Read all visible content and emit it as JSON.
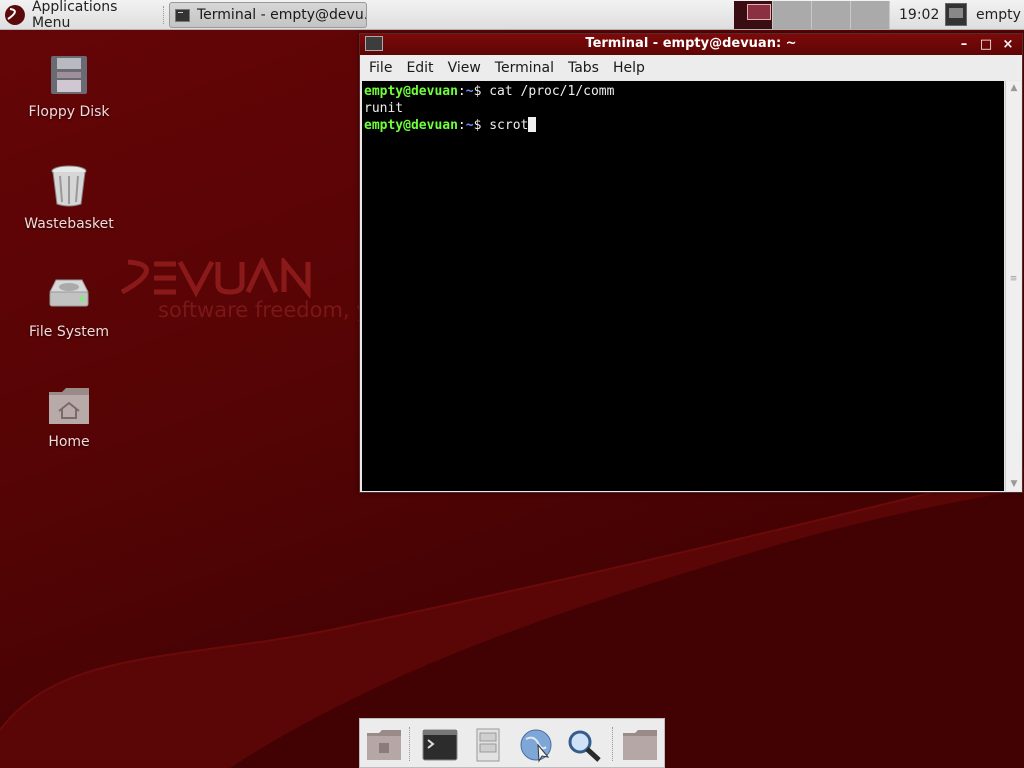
{
  "top_panel": {
    "apps_menu_label": "Applications Menu",
    "taskbar_title": "Terminal - empty@devu...",
    "clock": "19:02",
    "user": "empty",
    "workspace_count": 4,
    "active_workspace": 1
  },
  "wallpaper": {
    "logo_text": "DEVUAN",
    "tagline": "software freedom, y"
  },
  "desktop_icons": [
    {
      "label": "Floppy Disk"
    },
    {
      "label": "Wastebasket"
    },
    {
      "label": "File System"
    },
    {
      "label": "Home"
    }
  ],
  "terminal": {
    "title": "Terminal - empty@devuan: ~",
    "menu": [
      "File",
      "Edit",
      "View",
      "Terminal",
      "Tabs",
      "Help"
    ],
    "lines": [
      {
        "user": "empty@devuan",
        "sep": ":",
        "path": "~",
        "sym": "$ ",
        "cmd": "cat /proc/1/comm"
      },
      {
        "output": "runit"
      },
      {
        "user": "empty@devuan",
        "sep": ":",
        "path": "~",
        "sym": "$ ",
        "cmd": "scrot"
      }
    ]
  },
  "dock": {
    "items": [
      "show-desktop",
      "terminal",
      "file-cabinet",
      "web-browser",
      "search",
      "folder"
    ]
  },
  "colors": {
    "titlebar": "#6e0808",
    "desktop": "#560405",
    "prompt_user": "#6fff3a",
    "prompt_path": "#6f8fff"
  }
}
